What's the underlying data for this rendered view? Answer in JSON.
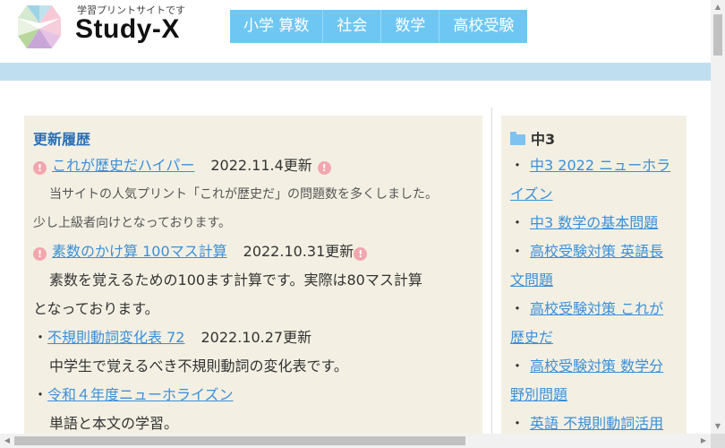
{
  "header": {
    "tagline": "学習プリントサイトです",
    "brand": "Study-X",
    "nav": [
      "小学 算数",
      "社会",
      "数学",
      "高校受験"
    ]
  },
  "updates": {
    "title": "更新履歴",
    "items": [
      {
        "link": "これが歴史だハイパー",
        "date": "2022.11.4更新",
        "desc": [
          "当サイトの人気プリント「これが歴史だ」の問題数を多くしました。",
          "少し上級者向けとなっております。"
        ]
      },
      {
        "link": "素数のかけ算 100マス計算",
        "date": "2022.10.31更新",
        "desc": [
          "素数を覚えるための100ます計算です。実際は80マス計算",
          "となっております。"
        ]
      },
      {
        "bullet": "・",
        "link": "不規則動詞変化表 72",
        "date": "2022.10.27更新",
        "desc": [
          "中学生で覚えるべき不規則動詞の変化表です。"
        ]
      },
      {
        "bullet": "・",
        "link": "令和４年度ニューホライズン",
        "desc": [
          "単語と本文の学習。"
        ]
      }
    ]
  },
  "sidebar": {
    "heading": "中3",
    "bullet": "・",
    "items": [
      [
        "中3 2022 ニューホラ",
        "イズン"
      ],
      [
        "中3 数学の基本問題"
      ],
      [
        "高校受験対策 英語長",
        "文問題"
      ],
      [
        "高校受験対策 これが",
        "歴史だ"
      ],
      [
        "高校受験対策 数学分",
        "野別問題"
      ],
      [
        "英語 不規則動詞活用"
      ]
    ]
  },
  "colors": {
    "nav": "#6ec7f3",
    "band": "#bfdff0",
    "panel": "#f3f0e3",
    "link": "#3b8fd9",
    "title": "#2a6fb7",
    "alert": "#f2a6ae"
  }
}
